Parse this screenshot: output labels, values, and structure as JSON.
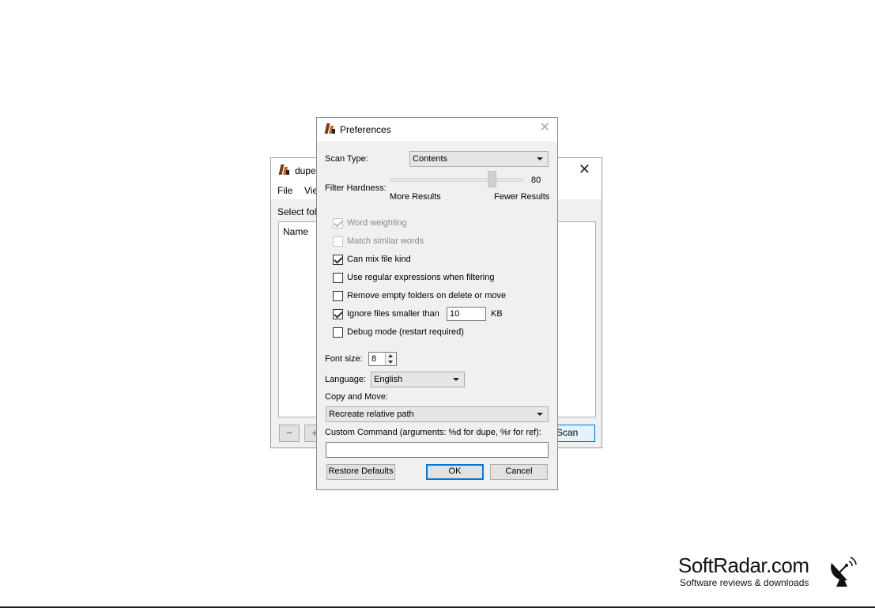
{
  "main_window": {
    "title": "dupe",
    "menu": [
      "File",
      "Vie"
    ],
    "select_label": "Select fold",
    "column_name": "Name",
    "remove_symbol": "−",
    "add_symbol": "+",
    "scan_label": "Scan",
    "close_symbol": "✕"
  },
  "dialog": {
    "title": "Preferences",
    "close_symbol": "✕",
    "scan_type_label": "Scan Type:",
    "scan_type_value": "Contents",
    "filter_hardness_label": "Filter Hardness:",
    "filter_hardness_value": "80",
    "slider_min_label": "More Results",
    "slider_max_label": "Fewer Results",
    "options": [
      {
        "label": "Word weighting",
        "checked": true,
        "enabled": false
      },
      {
        "label": "Match similar words",
        "checked": false,
        "enabled": false
      },
      {
        "label": "Can mix file kind",
        "checked": true,
        "enabled": true
      },
      {
        "label": "Use regular expressions when filtering",
        "checked": false,
        "enabled": true
      },
      {
        "label": "Remove empty folders on delete or move",
        "checked": false,
        "enabled": true
      },
      {
        "label": "Ignore files smaller than",
        "checked": true,
        "enabled": true
      },
      {
        "label": "Debug mode (restart required)",
        "checked": false,
        "enabled": true
      }
    ],
    "ignore_size_value": "10",
    "ignore_size_unit": "KB",
    "font_size_label": "Font size:",
    "font_size_value": "8",
    "language_label": "Language:",
    "language_value": "English",
    "copy_move_label": "Copy and Move:",
    "copy_move_value": "Recreate relative path",
    "custom_command_label": "Custom Command (arguments: %d for dupe, %r for ref):",
    "custom_command_value": "",
    "restore_defaults_label": "Restore Defaults",
    "ok_label": "OK",
    "cancel_label": "Cancel"
  },
  "watermark": {
    "name": "SoftRadar.com",
    "tagline": "Software reviews & downloads"
  }
}
